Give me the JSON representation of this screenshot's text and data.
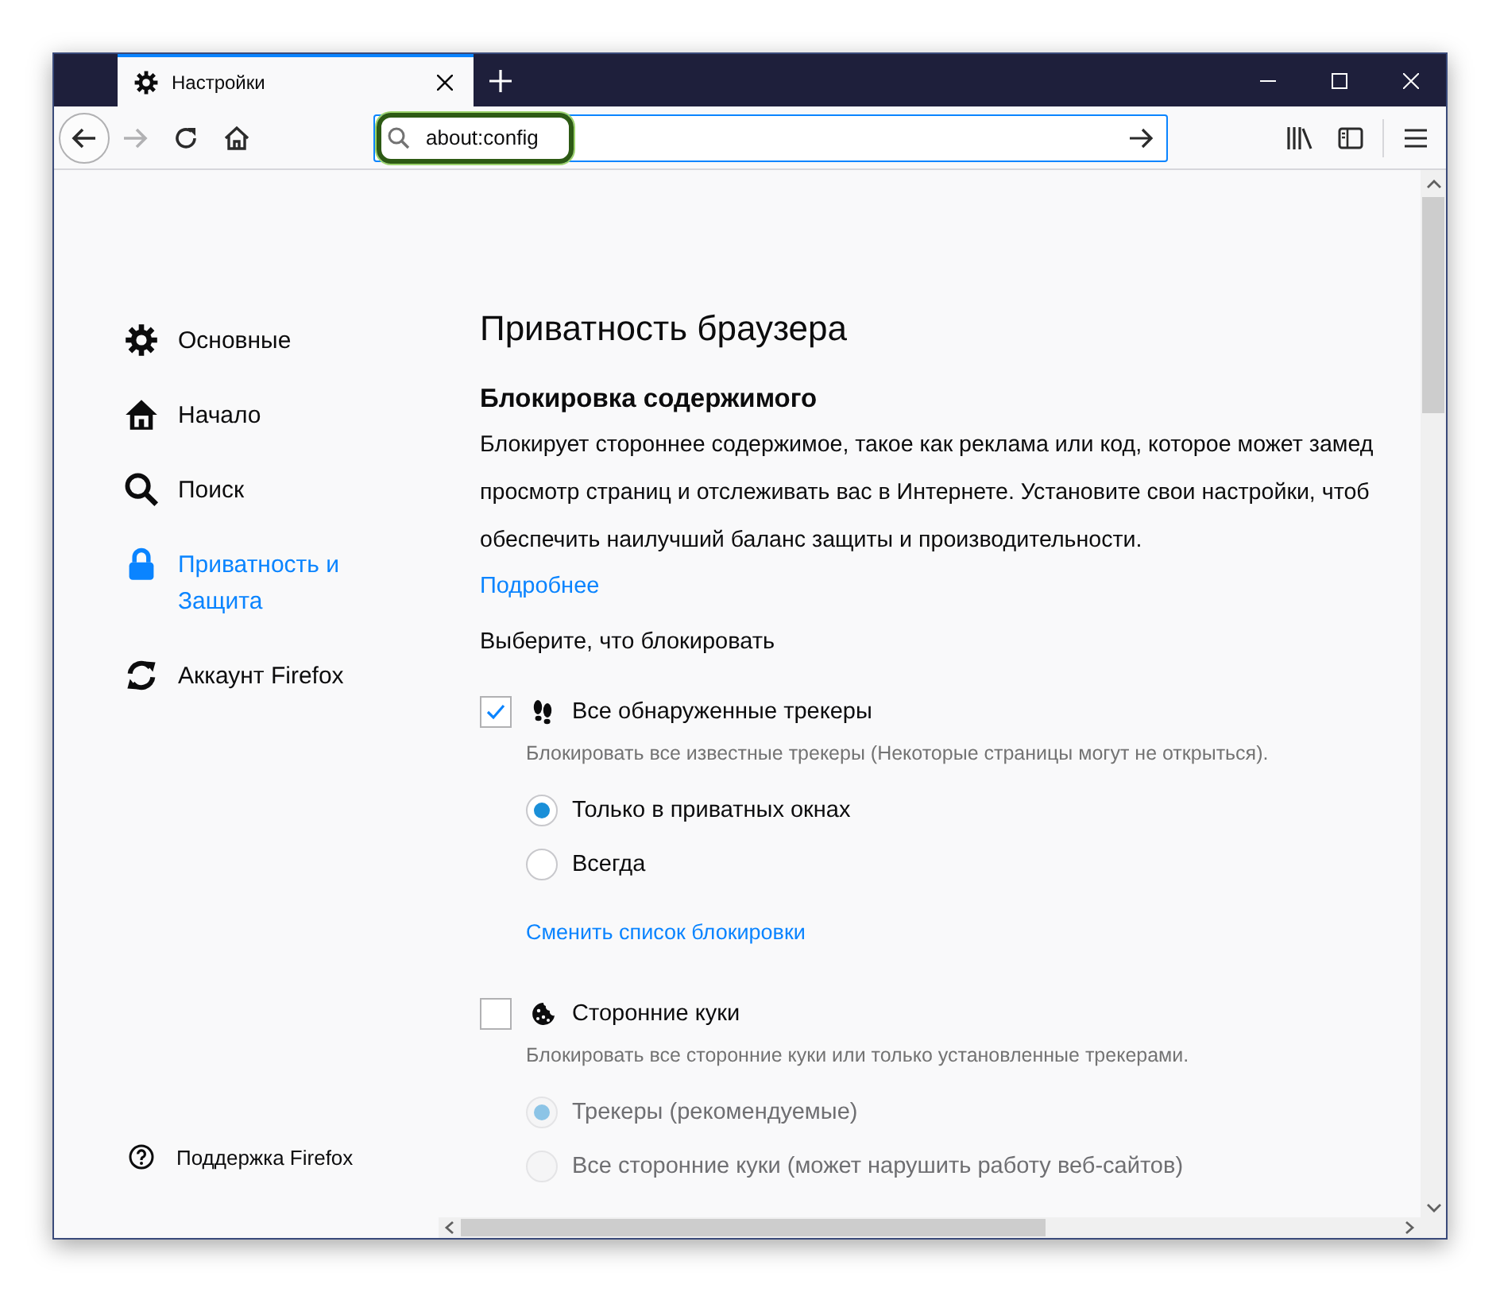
{
  "tabs": [
    {
      "title": "Настройки",
      "kind": "gear",
      "selected": true
    }
  ],
  "url_bar": {
    "value": "about:config",
    "focused": true
  },
  "sidebar": {
    "items": [
      {
        "label": "Основные",
        "kind": "gear",
        "selected": false
      },
      {
        "label": "Начало",
        "kind": "home",
        "selected": false
      },
      {
        "label": "Поиск",
        "kind": "search",
        "selected": false
      },
      {
        "label": "Приватность и Защита",
        "kind": "lock",
        "selected": true
      },
      {
        "label": "Аккаунт Firefox",
        "kind": "sync",
        "selected": false
      }
    ],
    "support": "Поддержка Firefox"
  },
  "main": {
    "title": "Приватность браузера",
    "heading": "Блокировка содержимого",
    "description_lines": [
      "Блокирует стороннее содержимое, такое как реклама или код, которое может замед",
      "просмотр страниц и отслеживать вас в Интернете. Установите свои настройки, чтоб",
      "обеспечить наилучший баланс защиты и производительности."
    ],
    "learn_more": "Подробнее",
    "prompt": "Выберите, что блокировать",
    "options": [
      {
        "label": "Все обнаруженные трекеры",
        "kind": "footprints",
        "checked": true,
        "description": "Блокировать все известные трекеры (Некоторые страницы могут не открыться).",
        "radios": [
          {
            "label": "Только в приватных окнах",
            "selected": true,
            "disabled": false
          },
          {
            "label": "Всегда",
            "selected": false,
            "disabled": false
          }
        ],
        "link": "Сменить список блокировки"
      },
      {
        "label": "Сторонние куки",
        "kind": "cookie",
        "checked": false,
        "description": "Блокировать все сторонние куки или только установленные трекерами.",
        "radios": [
          {
            "label": "Трекеры (рекомендуемые)",
            "selected": true,
            "disabled": true
          },
          {
            "label": "Все сторонние куки (может нарушить работу веб-сайтов)",
            "selected": false,
            "disabled": true
          }
        ]
      }
    ]
  }
}
